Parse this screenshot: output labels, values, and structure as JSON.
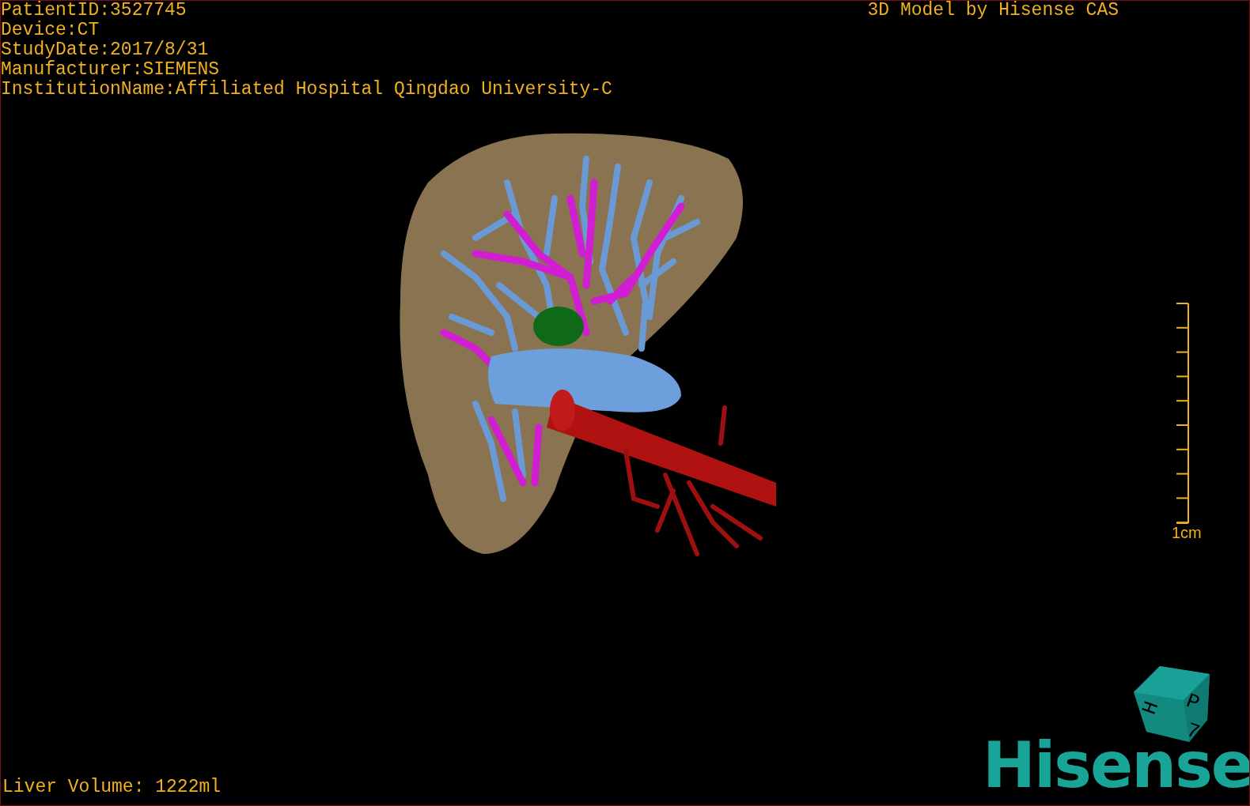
{
  "viewer": {
    "info_lines": [
      "PatientID:3527745",
      "Device:CT",
      "StudyDate:2017/8/31",
      "Manufacturer:SIEMENS",
      "InstitutionName:Affiliated Hospital Qingdao University-C"
    ],
    "title": "3D Model by Hisense CAS"
  },
  "scale_bar": {
    "label": "1cm"
  },
  "volume": "Liver Volume: 1222ml",
  "orientation_cube": {
    "labels": [
      "H",
      "P",
      "7"
    ]
  },
  "logo": "Hisense"
}
